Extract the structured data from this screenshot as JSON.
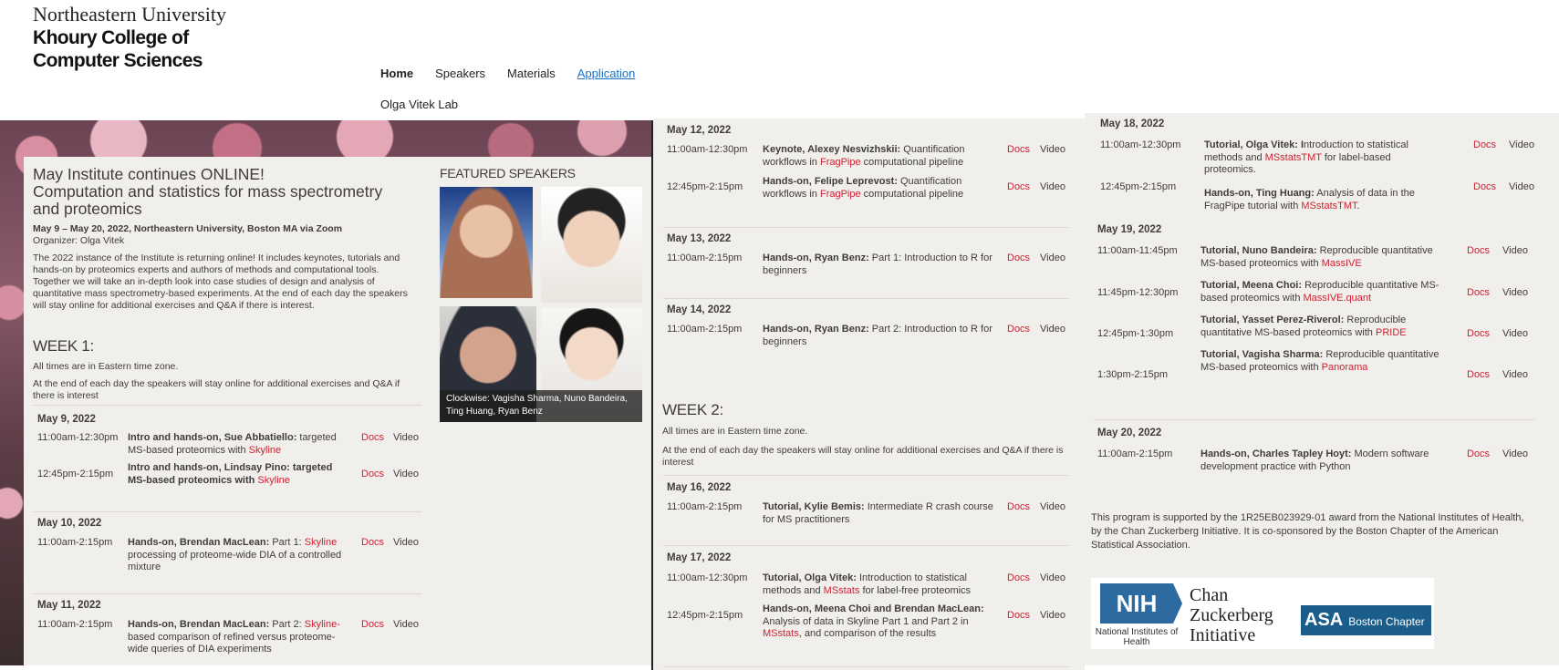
{
  "header": {
    "brand_line1": "Northeastern University",
    "brand_line2": "Khoury College of",
    "brand_line3": "Computer Sciences",
    "nav": [
      {
        "label": "Home",
        "state": "active"
      },
      {
        "label": "Speakers"
      },
      {
        "label": "Materials"
      },
      {
        "label": "Application",
        "state": "link"
      }
    ],
    "lab_link": "Olga Vitek Lab"
  },
  "intro": {
    "title_line1": "May Institute continues ONLINE!",
    "title_line2": "Computation and statistics for mass spectrometry",
    "title_line3": "and proteomics",
    "dates": "May 9 – May 20, 2022, Northeastern University, Boston MA via Zoom",
    "organizer": "Organizer: Olga Vitek",
    "description": "The 2022 instance of the Institute is returning online! It includes keynotes, tutorials and hands-on by proteomics experts and authors of methods and computational tools. Together we will take an in-depth look into case studies of design and analysis of quantitative mass spectrometry-based experiments. At the end of each day the speakers will stay online for additional exercises and Q&A if there is interest."
  },
  "featured": {
    "title": "FEATURED SPEAKERS",
    "caption": "Clockwise:  Vagisha Sharma, Nuno Bandeira, Ting Huang, Ryan Benz"
  },
  "week1": {
    "title": "WEEK 1:",
    "note1": "All times are in Eastern time zone.",
    "note2": "At the end of each day the speakers will stay online for additional exercises and Q&A if there is interest",
    "days": [
      {
        "date": "May 9, 2022",
        "sessions": [
          {
            "time": "11:00am-12:30pm",
            "lead": "Intro and hands-on, Sue Abbatiello:",
            "text": " targeted MS-based proteomics with ",
            "tool": "Skyline",
            "tail": ""
          },
          {
            "time": "12:45pm-2:15pm",
            "lead": "Intro and hands-on, Lindsay Pino: targeted MS-based proteomics with ",
            "text": "",
            "tool": "Skyline",
            "tail": ""
          }
        ]
      },
      {
        "date": "May 10, 2022",
        "sessions": [
          {
            "time": "11:00am-2:15pm",
            "lead": "Hands-on, Brendan MacLean:",
            "text": " Part 1:  ",
            "tool": "Skyline",
            "tail": " processing of proteome-wide DIA of a controlled mixture"
          }
        ]
      },
      {
        "date": "May 11, 2022",
        "sessions": [
          {
            "time": "11:00am-2:15pm",
            "lead": "Hands-on, Brendan MacLean:",
            "text": " Part 2: ",
            "tool": "Skyline-",
            "tail": "based comparison of refined versus proteome-wide queries of DIA experiments"
          }
        ]
      }
    ]
  },
  "mid": {
    "days": [
      {
        "date": "May 12, 2022",
        "sessions": [
          {
            "time": "11:00am-12:30pm",
            "lead": "Keynote, Alexey Nesvizhskii:",
            "text": " Quantification workflows in ",
            "tool": "FragPipe",
            "tail": " computational pipeline"
          },
          {
            "time": "12:45pm-2:15pm",
            "lead": "Hands-on, Felipe Leprevost:",
            "text": " Quantification workflows in ",
            "tool": "FragPipe",
            "tail": " computational pipeline"
          }
        ]
      },
      {
        "date": "May 13, 2022",
        "sessions": [
          {
            "time": "11:00am-2:15pm",
            "lead": "Hands-on, Ryan Benz:",
            "text": " Part 1: Introduction to R for beginners",
            "tool": "",
            "tail": ""
          }
        ]
      },
      {
        "date": "May 14, 2022",
        "sessions": [
          {
            "time": "11:00am-2:15pm",
            "lead": "Hands-on, Ryan Benz:",
            "text": " Part 2: Introduction to R for beginners",
            "tool": "",
            "tail": ""
          }
        ]
      }
    ],
    "week2_title": "WEEK 2:",
    "week2_note1": "All times are in Eastern time zone.",
    "week2_note2": "At the end of each day the speakers will stay online for additional exercises and Q&A if there is interest",
    "days2": [
      {
        "date": "May 16, 2022",
        "sessions": [
          {
            "time": "11:00am-2:15pm",
            "lead": "Tutorial, Kylie Bemis:",
            "text": " Intermediate R crash course for MS practitioners",
            "tool": "",
            "tail": ""
          }
        ]
      },
      {
        "date": "May 17, 2022",
        "sessions": [
          {
            "time": "11:00am-12:30pm",
            "lead": "Tutorial, Olga Vitek:",
            "text": " Introduction to statistical methods and ",
            "tool": "MSstats",
            "tail": " for label-free proteomics"
          },
          {
            "time": "12:45pm-2:15pm",
            "lead": "Hands-on, Meena Choi and Brendan MacLean:",
            "text": " Analysis of data in Skyline Part 1 and Part 2 in ",
            "tool": "MSstats",
            "tail": ", and comparison of the results"
          }
        ]
      }
    ]
  },
  "right": {
    "days": [
      {
        "date": "May 18, 2022",
        "sessions": [
          {
            "time": "11:00am-12:30pm",
            "lead": "Tutorial, Olga Vitek: I",
            "text": "ntroduction to statistical methods and ",
            "tool": "MSstatsTMT",
            "tail": " for label-based proteomics."
          },
          {
            "time": "12:45pm-2:15pm",
            "lead": "Hands-on, Ting Huang:",
            "text": " Analysis of data in the FragPipe tutorial with ",
            "tool": "MSstatsTMT",
            "tail": "."
          }
        ]
      },
      {
        "date": "May 19, 2022",
        "sessions": [
          {
            "time": "11:00am-11:45pm",
            "lead": "Tutorial, Nuno Bandeira:",
            "text": " Reproducible quantitative MS-based proteomics with ",
            "tool": "MassIVE",
            "tail": ""
          },
          {
            "time": "11:45pm-12:30pm",
            "lead": "Tutorial, Meena Choi:",
            "text": " Reproducible quantitative MS-based proteomics with ",
            "tool": "MassIVE.quant",
            "tail": ""
          },
          {
            "time": "12:45pm-1:30pm",
            "lead": "Tutorial, Yasset Perez-Riverol:",
            "text": " Reproducible quantitative MS-based proteomics with ",
            "tool": "PRIDE",
            "tail": ""
          },
          {
            "time": "1:30pm-2:15pm",
            "lead": "Tutorial, Vagisha Sharma:",
            "text": " Reproducible quantitative MS-based proteomics with ",
            "tool": "Panorama",
            "tail": ""
          }
        ]
      },
      {
        "date": "May 20, 2022",
        "sessions": [
          {
            "time": "11:00am-2:15pm",
            "lead": "Hands-on, Charles Tapley Hoyt:",
            "text": " Modern software development practice with Python",
            "tool": "",
            "tail": ""
          }
        ]
      }
    ],
    "support": "This program is supported by the 1R25EB023929-01 award from the National Institutes of Health, by the Chan Zuckerberg Initiative. It is co-sponsored by the Boston Chapter of the American Statistical Association."
  },
  "labels": {
    "docs": "Docs",
    "video": "Video"
  },
  "logos": {
    "nih": "NIH",
    "nih_sub": "National Institutes of Health",
    "czi_line1": "Chan",
    "czi_line2": "Zuckerberg",
    "czi_line3": "Initiative",
    "asa": "ASA",
    "asa_sub": "Boston Chapter"
  }
}
